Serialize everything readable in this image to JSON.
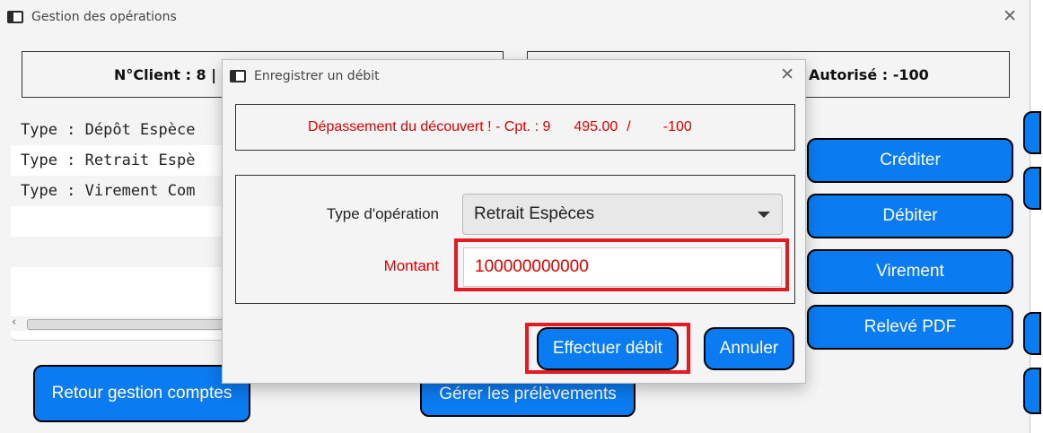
{
  "main": {
    "title": "Gestion des opérations",
    "client_info": "N°Client : 8 | N",
    "account_info": "Autorisé : -100",
    "operations": [
      "Type : Dépôt Espèce",
      "Type : Retrait Espè",
      "Type : Virement Com"
    ],
    "buttons": {
      "crediter": "Créditer",
      "debiter": "Débiter",
      "virement": "Virement",
      "releve_pdf": "Relevé PDF",
      "retour": "Retour gestion comptes",
      "prelevements": "Gérer les prélèvements"
    }
  },
  "dialog": {
    "title": "Enregistrer un débit",
    "warning": {
      "prefix": "Dépassement du découvert ! - Cpt. : 9",
      "amount": "495.00",
      "separator": "/",
      "limit": "-100"
    },
    "type_label": "Type d'opération",
    "type_value": "Retrait Espèces",
    "amount_label": "Montant",
    "amount_value": "100000000000",
    "submit_label": "Effectuer débit",
    "cancel_label": "Annuler"
  },
  "colors": {
    "button_blue": "#0a7bf0",
    "error_red": "#e00000",
    "highlight_red": "#e41b23"
  }
}
